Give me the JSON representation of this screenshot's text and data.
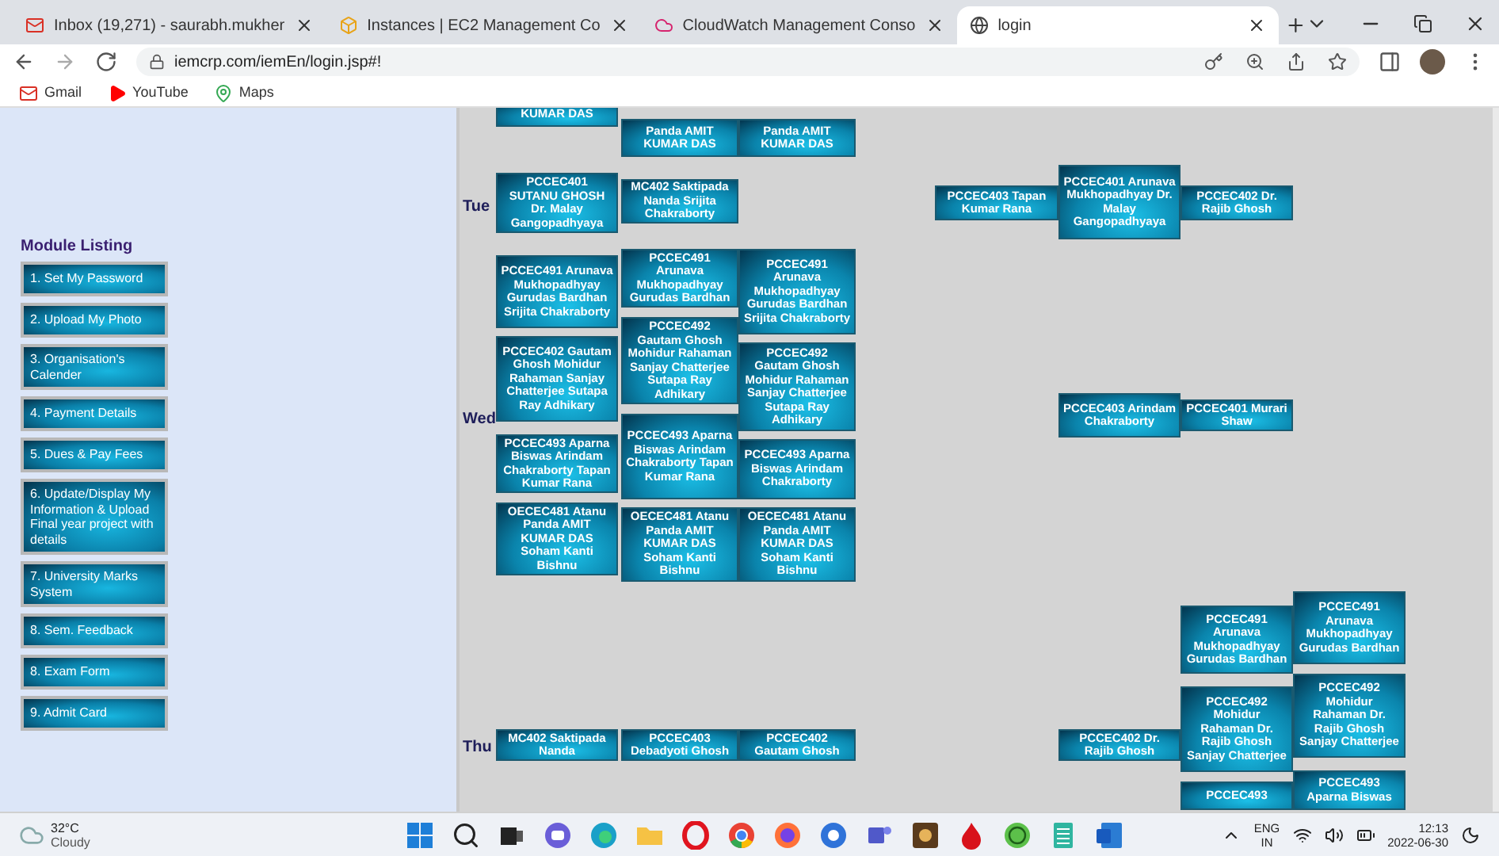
{
  "browser": {
    "tabs": [
      {
        "title": "Inbox (19,271) - saurabh.mukher",
        "kind": "mail",
        "selected": false
      },
      {
        "title": "Instances | EC2 Management Co",
        "kind": "cube",
        "selected": false
      },
      {
        "title": "CloudWatch Management Conso",
        "kind": "cloud",
        "selected": false
      },
      {
        "title": "login",
        "kind": "globe",
        "selected": true
      }
    ],
    "url": "iemcrp.com/iemEn/login.jsp#!",
    "bookmarks": [
      {
        "label": "Gmail",
        "kind": "mail"
      },
      {
        "label": "YouTube",
        "kind": "play"
      },
      {
        "label": "Maps",
        "kind": "map"
      }
    ]
  },
  "sidebar": {
    "heading": "Module Listing",
    "items": [
      {
        "label": "1. Set My Password"
      },
      {
        "label": "2. Upload My Photo"
      },
      {
        "label": "3. Organisation's Calender"
      },
      {
        "label": "4. Payment Details"
      },
      {
        "label": "5. Dues & Pay Fees"
      },
      {
        "label": "6. Update/Display My Information & Upload Final year project with details"
      },
      {
        "label": "7. University Marks System"
      },
      {
        "label": "8. Sem. Feedback"
      },
      {
        "label": "8. Exam Form"
      },
      {
        "label": "9. Admit Card"
      }
    ]
  },
  "timetable": {
    "days": [
      {
        "label": "Tue"
      },
      {
        "label": "Wed"
      },
      {
        "label": "Thu"
      }
    ],
    "cells": [
      {
        "text": "KUMAR DAS"
      },
      {
        "text": "Panda AMIT KUMAR DAS"
      },
      {
        "text": "Panda AMIT KUMAR DAS"
      },
      {
        "text": "PCCEC401 SUTANU GHOSH Dr. Malay Gangopadhyaya"
      },
      {
        "text": "MC402 Saktipada Nanda Srijita Chakraborty"
      },
      {
        "text": "PCCEC403 Tapan Kumar Rana"
      },
      {
        "text": "PCCEC401 Arunava Mukhopadhyay Dr. Malay Gangopadhyaya"
      },
      {
        "text": "PCCEC402 Dr. Rajib Ghosh"
      },
      {
        "text": "PCCEC491 Arunava Mukhopadhyay Gurudas Bardhan Srijita Chakraborty"
      },
      {
        "text": "PCCEC491 Arunava Mukhopadhyay Gurudas Bardhan"
      },
      {
        "text": "PCCEC491 Arunava Mukhopadhyay Gurudas Bardhan Srijita Chakraborty"
      },
      {
        "text": "PCCEC402 Gautam Ghosh Mohidur Rahaman Sanjay Chatterjee Sutapa Ray Adhikary"
      },
      {
        "text": "PCCEC492 Gautam Ghosh Mohidur Rahaman Sanjay Chatterjee Sutapa Ray Adhikary"
      },
      {
        "text": "PCCEC492 Gautam Ghosh Mohidur Rahaman Sanjay Chatterjee Sutapa Ray Adhikary"
      },
      {
        "text": "PCCEC493 Aparna Biswas Arindam Chakraborty Tapan Kumar Rana"
      },
      {
        "text": "PCCEC493 Aparna Biswas Arindam Chakraborty Tapan Kumar Rana"
      },
      {
        "text": "PCCEC493 Aparna Biswas Arindam Chakraborty"
      },
      {
        "text": "OECEC481 Atanu Panda AMIT KUMAR DAS Soham Kanti Bishnu"
      },
      {
        "text": "OECEC481 Atanu Panda AMIT KUMAR DAS Soham Kanti Bishnu"
      },
      {
        "text": "OECEC481 Atanu Panda AMIT KUMAR DAS Soham Kanti Bishnu"
      },
      {
        "text": "PCCEC403 Arindam Chakraborty"
      },
      {
        "text": "PCCEC401 Murari Shaw"
      },
      {
        "text": "PCCEC491 Arunava Mukhopadhyay Gurudas Bardhan"
      },
      {
        "text": "PCCEC491 Arunava Mukhopadhyay Gurudas Bardhan"
      },
      {
        "text": "PCCEC492 Mohidur Rahaman Dr. Rajib Ghosh Sanjay Chatterjee"
      },
      {
        "text": "PCCEC492 Mohidur Rahaman Dr. Rajib Ghosh Sanjay Chatterjee"
      },
      {
        "text": "MC402 Saktipada Nanda"
      },
      {
        "text": "PCCEC403 Debadyoti Ghosh"
      },
      {
        "text": "PCCEC402 Gautam Ghosh"
      },
      {
        "text": "PCCEC402 Dr. Rajib Ghosh"
      },
      {
        "text": "PCCEC493"
      },
      {
        "text": "PCCEC493 Aparna Biswas"
      }
    ]
  },
  "taskbar": {
    "temperature": "32°C",
    "weather": "Cloudy",
    "apps": [
      {
        "kind": "start"
      },
      {
        "kind": "search"
      },
      {
        "kind": "taskview"
      },
      {
        "kind": "chat"
      },
      {
        "kind": "edge"
      },
      {
        "kind": "folder"
      },
      {
        "kind": "opera"
      },
      {
        "kind": "chrome"
      },
      {
        "kind": "firefox"
      },
      {
        "kind": "chromebeta"
      },
      {
        "kind": "teams"
      },
      {
        "kind": "app"
      },
      {
        "kind": "flame"
      },
      {
        "kind": "green"
      },
      {
        "kind": "notepad"
      },
      {
        "kind": "word"
      }
    ],
    "language": "ENG",
    "region": "IN",
    "time": "12:13",
    "date": "2022-06-30"
  }
}
